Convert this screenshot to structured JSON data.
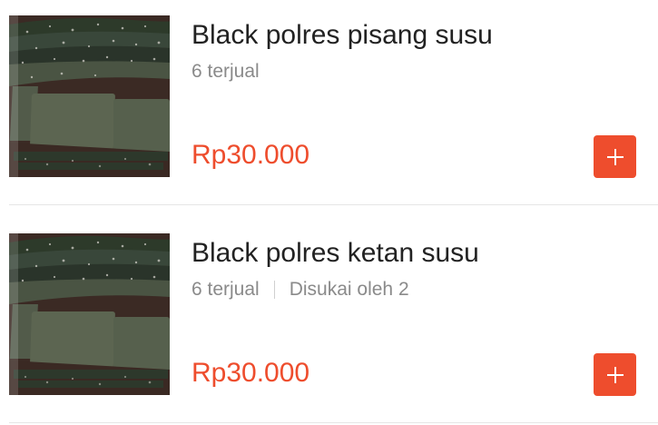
{
  "products": [
    {
      "name": "Black polres pisang susu",
      "sold": "6 terjual",
      "likes": "",
      "price": "Rp30.000",
      "add_label": "+",
      "thumbnail": "product-photo"
    },
    {
      "name": "Black polres ketan susu",
      "sold": "6 terjual",
      "likes": "Disukai oleh 2",
      "price": "Rp30.000",
      "add_label": "+",
      "thumbnail": "product-photo"
    }
  ],
  "colors": {
    "accent": "#ee4d2d",
    "text": "#222222",
    "muted": "#8a8a8a",
    "divider": "#e6e6e6"
  },
  "icons": {
    "add": "plus-icon"
  }
}
